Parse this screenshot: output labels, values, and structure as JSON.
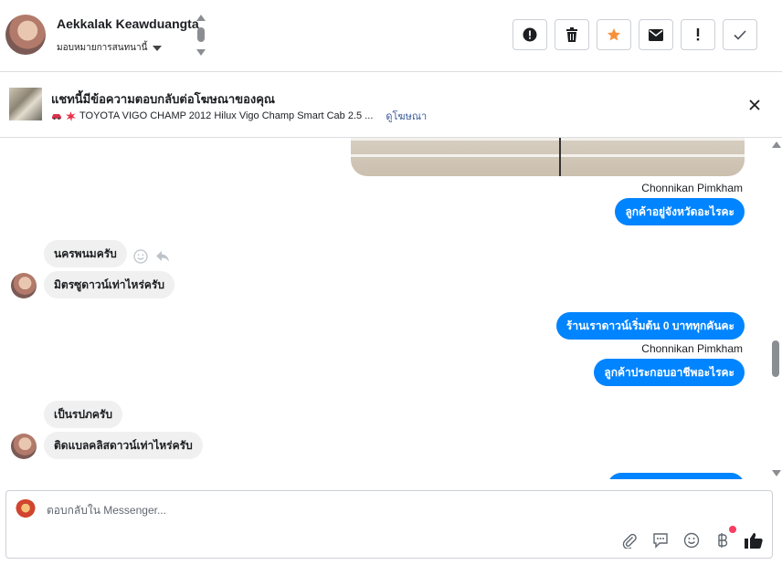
{
  "header": {
    "user_name": "Aekkalak Keawduangta",
    "assign_label": "มอบหมายการสนทนานี้",
    "actions": [
      {
        "name": "report-button",
        "icon": "alert-circle-icon"
      },
      {
        "name": "delete-button",
        "icon": "trash-icon"
      },
      {
        "name": "star-button",
        "icon": "star-icon"
      },
      {
        "name": "mark-unread-button",
        "icon": "envelope-icon"
      },
      {
        "name": "follow-up-button",
        "icon": "exclamation-icon"
      },
      {
        "name": "done-button",
        "icon": "checkmark-icon"
      }
    ],
    "star_color": "#f7923b"
  },
  "ad": {
    "title": "แชทนี้มีข้อความตอบกลับต่อโฆษณาของคุณ",
    "subtitle": "TOYOTA VIGO CHAMP 2012 Hilux Vigo Champ Smart Cab 2.5 ...",
    "link": "ดูโฆษณา"
  },
  "messages": {
    "sender_1": "Chonnikan Pimkham",
    "out_1": "ลูกค้าอยู่จังหวัดอะไรคะ",
    "in_1": "นครพนมครับ",
    "in_2": "มิตรซูดาวน์เท่าไหร่ครับ",
    "out_2": "ร้านเราดาวน์เริ่มต้น 0 บาททุกคันคะ",
    "sender_2": "Chonnikan Pimkham",
    "out_3": "ลูกค้าประกอบอาชีพอะไรคะ",
    "in_3": "เป็นรปภครับ",
    "in_4": "ติดแบลคลิสดาวน์เท่าไหร่ครับ"
  },
  "composer": {
    "placeholder": "ตอบกลับใน Messenger..."
  },
  "colors": {
    "outgoing_bubble": "#0084ff",
    "incoming_bubble": "#f0f0f0",
    "link": "#385898"
  }
}
